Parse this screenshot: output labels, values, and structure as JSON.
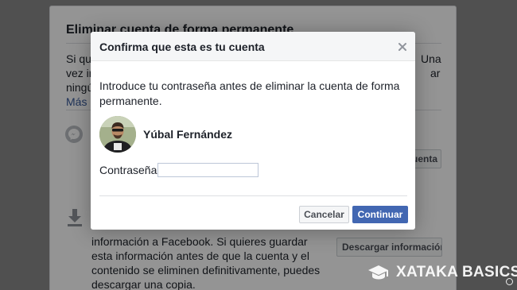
{
  "background_page": {
    "section_title": "Eliminar cuenta de forma permanente",
    "paragraph_fragments": {
      "line1_left": "Si qui",
      "line1_right": "Una",
      "line2_left": "vez in",
      "line2_right": "ar",
      "line3_left": "ningú",
      "link_fragment": "Más i"
    },
    "messenger_button_fragment": "uenta",
    "download_text": "información a Facebook. Si quieres guardar esta información antes de que la cuenta y el contenido se eliminen definitivamente, puedes descargar una copia.",
    "download_button": "Descargar información"
  },
  "modal": {
    "title": "Confirma que esta es tu cuenta",
    "intro_line1": "Introduce tu contraseña antes de eliminar la cuenta de forma",
    "intro_line2": "permanente.",
    "user_name": "Yúbal Fernández",
    "password_label": "Contraseña:",
    "password_value": "",
    "cancel_label": "Cancelar",
    "continue_label": "Continuar",
    "close_glyph": "×"
  },
  "watermark": {
    "text": "XATAKA BASICS"
  },
  "colors": {
    "primary_button": "#4267b2",
    "link": "#365899",
    "header_bg": "#f5f6f7"
  },
  "icons": [
    "messenger-icon",
    "download-icon",
    "close-icon",
    "graduation-cap-icon"
  ]
}
